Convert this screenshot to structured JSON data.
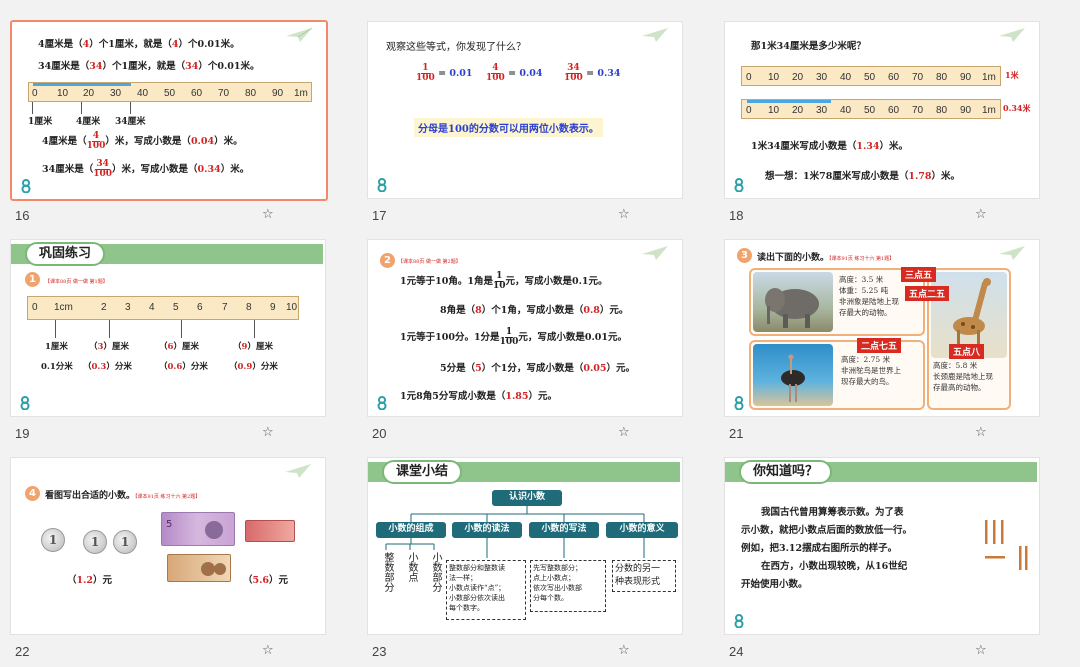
{
  "slides": {
    "s16": {
      "number": "16",
      "line1": [
        "4厘米是（",
        "4",
        "）个1厘米，就是（",
        "4",
        "）个0.01米。"
      ],
      "line2": [
        "34厘米是（",
        "34",
        "）个1厘米，就是（",
        "34",
        "）个0.01米。"
      ],
      "ruler_labels": [
        "0",
        "10",
        "20",
        "30",
        "40",
        "50",
        "60",
        "70",
        "80",
        "90",
        "1m"
      ],
      "under_labels": [
        "1厘米",
        "4厘米",
        "34厘米"
      ],
      "line3_pre": "4厘米是（",
      "line3_num": "4",
      "line3_den": "100",
      "line3_mid": "）米，写成小数是（",
      "line3_val": "0.04",
      "line3_post": "）米。",
      "line4_pre": "34厘米是（",
      "line4_num": "34",
      "line4_den": "100",
      "line4_mid": "）米，写成小数是（",
      "line4_val": "0.34",
      "line4_post": "）米。"
    },
    "s17": {
      "number": "17",
      "prompt": "观察这些等式，你发现了什么？",
      "eqs": [
        {
          "num": "1",
          "den": "100",
          "val": "0.01"
        },
        {
          "num": "4",
          "den": "100",
          "val": "0.04"
        },
        {
          "num": "34",
          "den": "100",
          "val": "0.34"
        }
      ],
      "eq_sign": "=",
      "conclusion": "分母是100的分数可以用两位小数表示。"
    },
    "s18": {
      "number": "18",
      "question": "那1米34厘米是多少米呢？",
      "ruler_labels": [
        "0",
        "10",
        "20",
        "30",
        "40",
        "50",
        "60",
        "70",
        "80",
        "90",
        "1m"
      ],
      "ruler1_tag": "1米",
      "ruler2_tag": "0.34米",
      "answer_pre": "1米34厘米写成小数是（",
      "answer_val": "1.34",
      "answer_post": "）米。",
      "think_pre": "想一想：1米78厘米写成小数是（",
      "think_val": "1.78",
      "think_post": "）米。"
    },
    "s19": {
      "number": "19",
      "header": "巩固练习",
      "badge": "1",
      "source": "【课本88页 做一做 第1题】",
      "ruler_labels": [
        "0",
        "1cm",
        "2",
        "3",
        "4",
        "5",
        "6",
        "7",
        "8",
        "9",
        "10"
      ],
      "row1": [
        {
          "pre": "1厘米",
          "val": "",
          "post": ""
        },
        {
          "pre": "（",
          "val": "3",
          "post": "）厘米"
        },
        {
          "pre": "（",
          "val": "6",
          "post": "）厘米"
        },
        {
          "pre": "（",
          "val": "9",
          "post": "）厘米"
        }
      ],
      "row2": [
        {
          "pre": "0.1分米",
          "val": "",
          "post": ""
        },
        {
          "pre": "（",
          "val": "0.3",
          "post": "）分米"
        },
        {
          "pre": "（",
          "val": "0.6",
          "post": "）分米"
        },
        {
          "pre": "（",
          "val": "0.9",
          "post": "）分米"
        }
      ]
    },
    "s20": {
      "number": "20",
      "badge": "2",
      "source": "【课本88页 做一做 第2题】",
      "l1_pre": "1元等于10角。1角是",
      "l1_num": "1",
      "l1_den": "10",
      "l1_post": "元，写成小数是0.1元。",
      "l2_pre": "8角是（",
      "l2_val1": "8",
      "l2_mid": "）个1角，写成小数是（",
      "l2_val2": "0.8",
      "l2_post": "）元。",
      "l3_pre": "1元等于100分。1分是",
      "l3_num": "1",
      "l3_den": "100",
      "l3_post": "元，写成小数是0.01元。",
      "l4_pre": "5分是（",
      "l4_val1": "5",
      "l4_mid": "）个1分，写成小数是（",
      "l4_val2": "0.05",
      "l4_post": "）元。",
      "l5_pre": "1元8角5分写成小数是（",
      "l5_val": "1.85",
      "l5_post": "）元。"
    },
    "s21": {
      "number": "21",
      "badge": "3",
      "title": "读出下面的小数。",
      "source": "【课本91页 练习十六 第1题】",
      "elephant_text": [
        "高度：3.5 米",
        "体重：5.25 吨",
        "非洲象是陆地上现",
        "存最大的动物。"
      ],
      "ostrich_text": [
        "高度：2.75 米",
        "非洲鸵鸟是世界上",
        "现存最大的鸟。"
      ],
      "giraffe_text": [
        "高度：5.8 米",
        "长颈鹿是陆地上现",
        "存最高的动物。"
      ],
      "tags": [
        "三点五",
        "五点二五",
        "二点七五",
        "五点八"
      ]
    },
    "s22": {
      "number": "22",
      "badge": "4",
      "title": "看图写出合适的小数。",
      "source": "【课本91页 练习十六 第2题】",
      "coin_label": "1",
      "ans1_pre": "（",
      "ans1_val": "1.2",
      "ans1_post": "）元",
      "ans2_pre": "（",
      "ans2_val": "5.6",
      "ans2_post": "）元"
    },
    "s23": {
      "number": "23",
      "header": "课堂小结",
      "root": "认识小数",
      "branches": [
        "小数的组成",
        "小数的读法",
        "小数的写法",
        "小数的意义"
      ],
      "composition": [
        "整数部分",
        "小数点",
        "小数部分"
      ],
      "reading": [
        "整数部分和整数读",
        "法一样；",
        "小数点读作“点”；",
        "小数部分依次读出",
        "每个数字。"
      ],
      "writing": [
        "先写整数部分；",
        "点上小数点；",
        "依次写出小数部",
        "分每个数。"
      ],
      "meaning": [
        "分数的另一",
        "种表现形式"
      ]
    },
    "s24": {
      "number": "24",
      "header": "你知道吗？",
      "para1": [
        "我国古代曾用算筹表示数。为了表",
        "示小数，就把小数点后面的数放低一行。",
        "例如，把3.12摆成右图所示的样子。"
      ],
      "para2": [
        "在西方，小数出现较晚，从16世纪",
        "开始使用小数。"
      ]
    }
  },
  "star_icon": "☆",
  "colors": {
    "accent_red": "#d32222",
    "accent_blue": "#2b3fcf",
    "header_green": "#8fc48a",
    "node_teal": "#1f6b7a",
    "selected_border": "#f28a6a"
  }
}
